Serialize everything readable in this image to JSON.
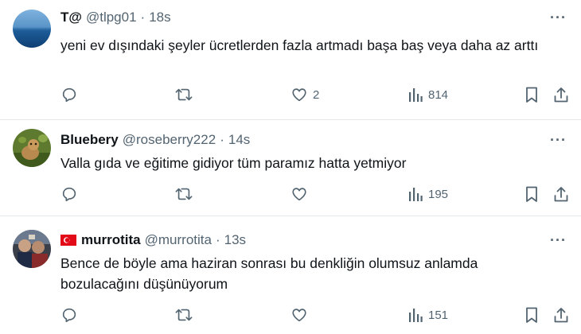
{
  "tweets": [
    {
      "name": "T@",
      "handle": "@tlpg01",
      "time": "18s",
      "text": "yeni ev dışındaki şeyler ücretlerden fazla artmadı başa baş veya daha az arttı",
      "replies": "",
      "retweets": "",
      "likes": "2",
      "views": "814"
    },
    {
      "name": "Bluebery",
      "handle": "@roseberry222",
      "time": "14s",
      "text": "Valla gıda ve eğitime gidiyor tüm paramız hatta yetmiyor",
      "replies": "",
      "retweets": "",
      "likes": "",
      "views": "195"
    },
    {
      "name": "murrotita",
      "handle": "@murrotita",
      "time": "13s",
      "text": "Bence de böyle ama haziran sonrası bu denkliğin olumsuz anlamda bozulacağını düşünüyorum",
      "replies": "",
      "retweets": "",
      "likes": "",
      "views": "151"
    }
  ],
  "icons": {
    "reply": "reply-icon",
    "retweet": "retweet-icon",
    "like": "heart-icon",
    "views": "views-icon",
    "bookmark": "bookmark-icon",
    "share": "share-icon",
    "more": "more-icon",
    "flag": "turkey-flag-icon"
  },
  "colors": {
    "text": "#0f1419",
    "secondary": "#536471",
    "divider": "#e6e9ec",
    "flag_red": "#e30a17"
  },
  "separator": "·",
  "more_glyph": "···"
}
